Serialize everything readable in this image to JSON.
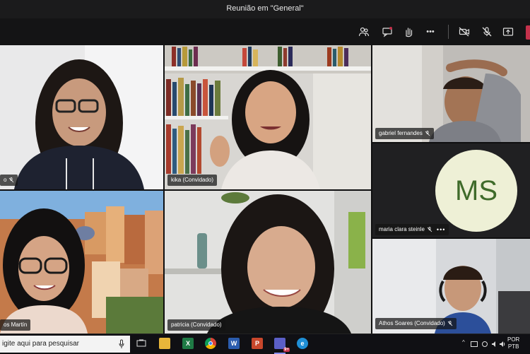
{
  "window": {
    "title": "Reunião em \"General\""
  },
  "toolbar": {
    "buttons": [
      "participants-icon",
      "chat-icon",
      "raise-hand-icon",
      "more-options-icon",
      "camera-off-icon",
      "mic-off-icon",
      "share-icon"
    ],
    "more_label": "•••"
  },
  "participants": [
    {
      "name": "o",
      "muted": true
    },
    {
      "name": "kika (Convidado)",
      "muted": false
    },
    {
      "name": "gabriel fernandes",
      "muted": true
    },
    {
      "name": "maria clara steinle",
      "muted": true,
      "initials": "MS",
      "more": "•••"
    },
    {
      "name": "os Martín",
      "muted": false
    },
    {
      "name": "patricia (Convidado)",
      "muted": false
    },
    {
      "name": "Athos Soares (Convidado)",
      "muted": true
    }
  ],
  "taskbar": {
    "search_placeholder": "igite aqui para pesquisar",
    "apps": [
      "task-view-icon",
      "file-explorer-icon",
      "excel-icon",
      "chrome-icon",
      "word-icon",
      "powerpoint-icon",
      "teams-icon",
      "edge-icon"
    ],
    "teams_badge": "9+",
    "lang_top": "POR",
    "lang_bottom": "PTB"
  },
  "colors": {
    "avatar_bg": "#eef0d6",
    "avatar_text": "#3f6b2a",
    "leave": "#c4314b"
  }
}
